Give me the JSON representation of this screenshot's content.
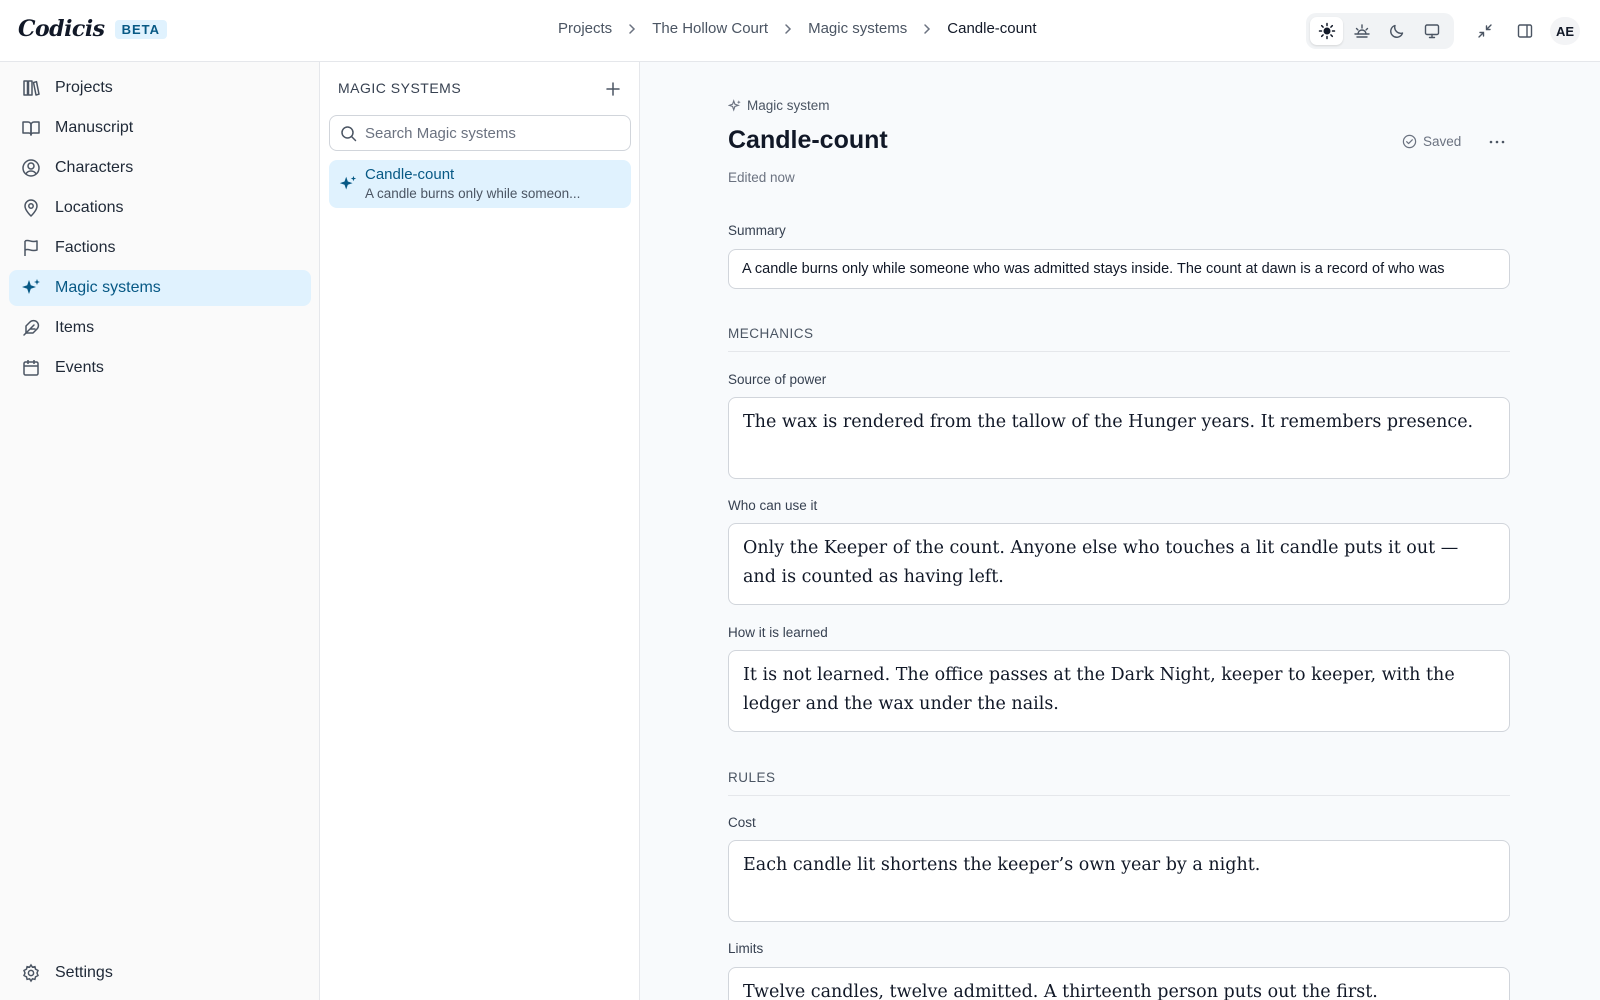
{
  "app": {
    "name": "Codicis",
    "badge": "BETA"
  },
  "breadcrumb": [
    "Projects",
    "The Hollow Court",
    "Magic systems",
    "Candle-count"
  ],
  "header": {
    "theme_buttons": [
      "sun-icon",
      "sunset-icon",
      "moon-icon",
      "monitor-icon"
    ],
    "active_theme": "sun-icon",
    "icons": [
      "collapse-icon",
      "panel-toggle-icon"
    ],
    "avatar_initials": "AE"
  },
  "sidebar": {
    "items": [
      {
        "label": "Projects",
        "icon": "library-icon"
      },
      {
        "label": "Manuscript",
        "icon": "book-open-icon"
      },
      {
        "label": "Characters",
        "icon": "user-circle-icon"
      },
      {
        "label": "Locations",
        "icon": "map-pin-icon"
      },
      {
        "label": "Factions",
        "icon": "flag-icon"
      },
      {
        "label": "Magic systems",
        "icon": "sparkles-icon",
        "active": true
      },
      {
        "label": "Items",
        "icon": "feather-icon"
      },
      {
        "label": "Events",
        "icon": "calendar-icon"
      }
    ],
    "settings_label": "Settings"
  },
  "list": {
    "title": "MAGIC SYSTEMS",
    "search_placeholder": "Search Magic systems",
    "items": [
      {
        "title": "Candle-count",
        "subtitle": "A candle burns only while someon..."
      }
    ]
  },
  "main": {
    "kind": "Magic system",
    "title": "Candle-count",
    "edited": "Edited now",
    "saved": "Saved",
    "summary_label": "Summary",
    "summary_value": "A candle burns only while someone who was admitted stays inside. The count at dawn is a record of who was",
    "mechanics_heading": "MECHANICS",
    "source_label": "Source of power",
    "source_value": "The wax is rendered from the tallow of the Hunger years. It remembers presence.",
    "who_label": "Who can use it",
    "who_value": "Only the Keeper of the count. Anyone else who touches a lit candle puts it out — and is counted as having left.",
    "learned_label": "How it is learned",
    "learned_value": "It is not learned. The office passes at the Dark Night, keeper to keeper, with the ledger and the wax under the nails.",
    "rules_heading": "RULES",
    "cost_label": "Cost",
    "cost_value": "Each candle lit shortens the keeper’s own year by a night.",
    "limits_label": "Limits",
    "limits_value": "Twelve candles, twelve admitted. A thirteenth person puts out the first."
  },
  "colors": {
    "accent": "#075985",
    "accent_bg": "#e0f2fe",
    "border": "#d1d5db"
  }
}
